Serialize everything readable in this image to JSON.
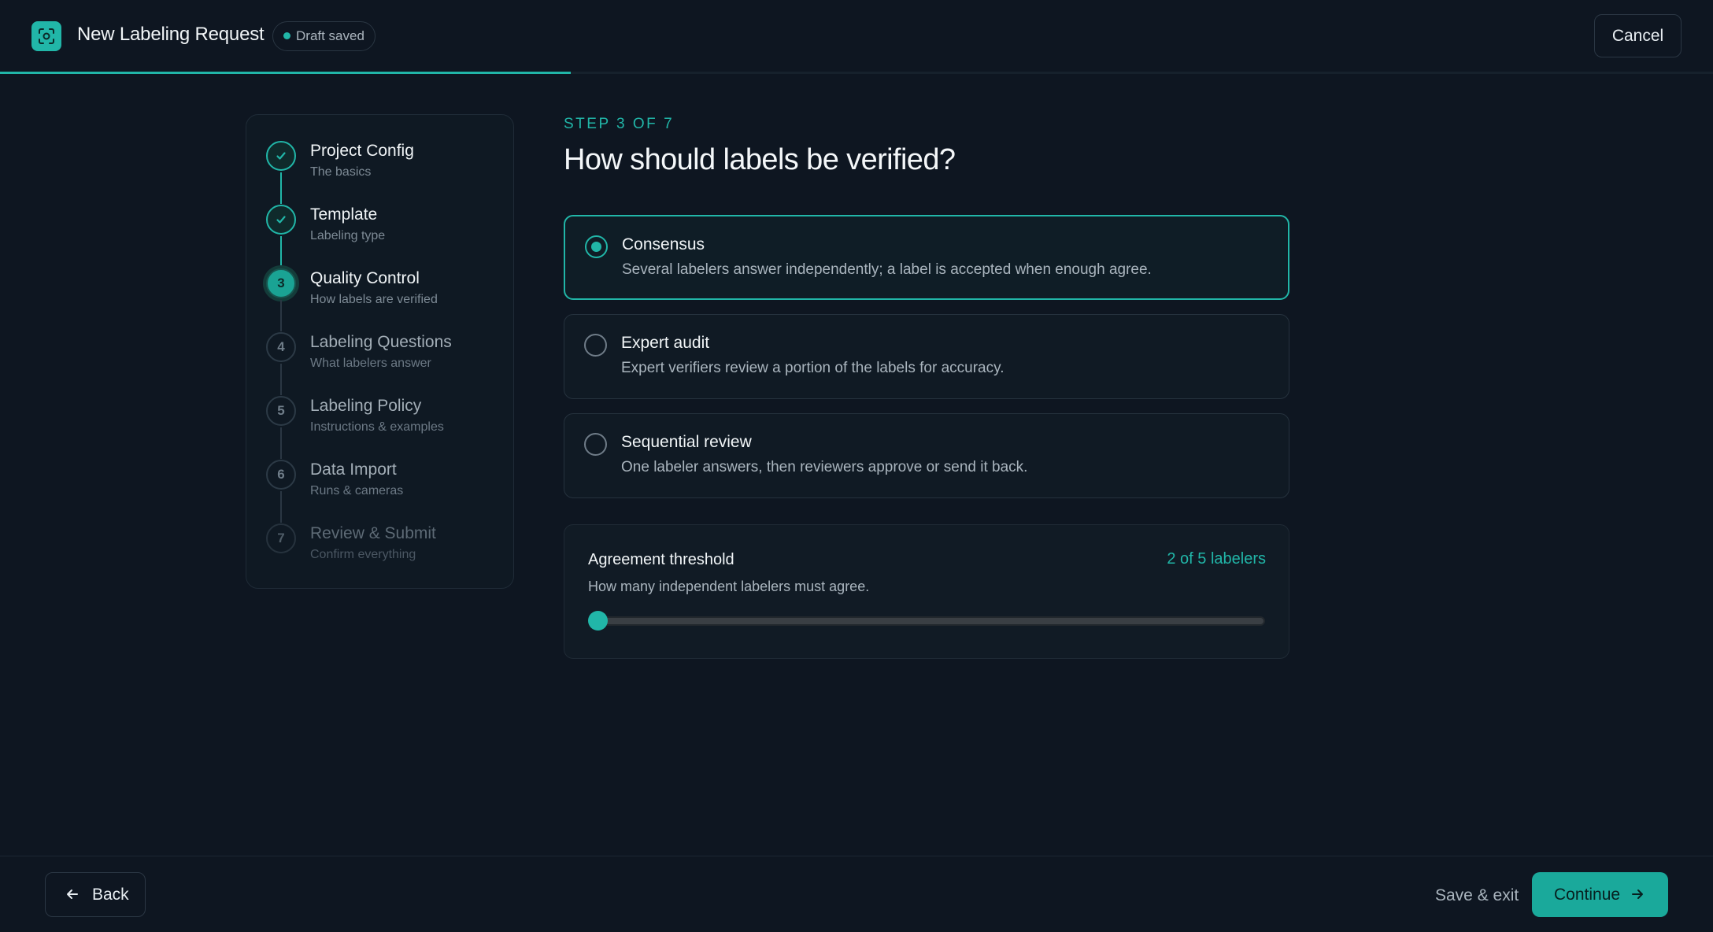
{
  "header": {
    "app_title": "New Labeling Request",
    "draft_badge": "Draft saved",
    "cancel_label": "Cancel",
    "progress_fraction": 0.333
  },
  "stepper": {
    "steps": [
      {
        "number": "1",
        "label": "Project Config",
        "sublabel": "The basics",
        "state": "done"
      },
      {
        "number": "2",
        "label": "Template",
        "sublabel": "Labeling type",
        "state": "done"
      },
      {
        "number": "3",
        "label": "Quality Control",
        "sublabel": "How labels are verified",
        "state": "current"
      },
      {
        "number": "4",
        "label": "Labeling Questions",
        "sublabel": "What labelers answer",
        "state": "upcoming"
      },
      {
        "number": "5",
        "label": "Labeling Policy",
        "sublabel": "Instructions & examples",
        "state": "upcoming"
      },
      {
        "number": "6",
        "label": "Data Import",
        "sublabel": "Runs & cameras",
        "state": "upcoming"
      },
      {
        "number": "7",
        "label": "Review & Submit",
        "sublabel": "Confirm everything",
        "state": "upcoming"
      }
    ]
  },
  "main": {
    "kicker": "STEP 3 OF 7",
    "heading": "How should labels be verified?",
    "options": [
      {
        "title": "Consensus",
        "description": "Several labelers answer independently; a label is accepted when enough agree.",
        "selected": true
      },
      {
        "title": "Expert audit",
        "description": "Expert verifiers review a portion of the labels for accuracy.",
        "selected": false
      },
      {
        "title": "Sequential review",
        "description": "One labeler answers, then reviewers approve or send it back.",
        "selected": false
      }
    ],
    "threshold": {
      "title": "Agreement threshold",
      "value_text": "2 of 5 labelers",
      "description": "How many independent labelers must agree.",
      "value": 2,
      "min": 2,
      "max": 5
    }
  },
  "footer": {
    "back_label": "Back",
    "save_exit_label": "Save & exit",
    "continue_label": "Continue"
  },
  "colors": {
    "accent": "#21b6a8",
    "background": "#0e1621"
  },
  "icons": {
    "logo": "scan-focus-icon",
    "done": "check-icon",
    "back": "arrow-left-icon",
    "continue": "arrow-right-icon"
  }
}
